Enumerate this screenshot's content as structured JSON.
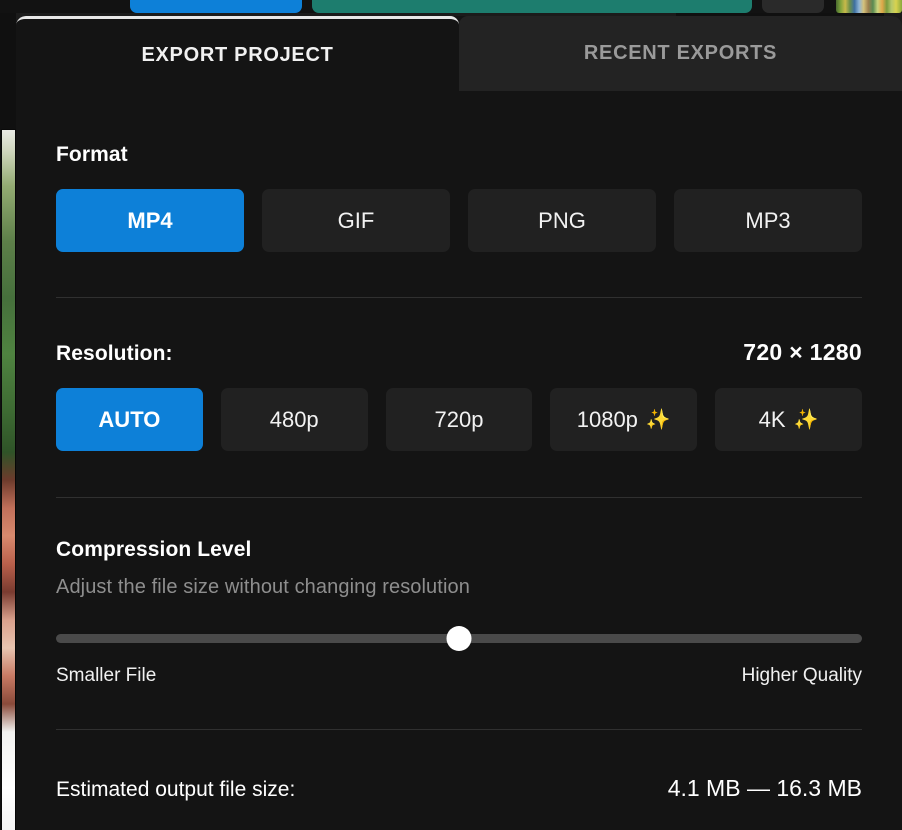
{
  "background": {
    "topbar_pill_blue": "",
    "topbar_pill_teal": "",
    "topbar_pill_dark": "",
    "filmstrip_thumbnail": "",
    "preview_strip": ""
  },
  "modal": {
    "tabs": [
      {
        "label": "EXPORT PROJECT",
        "active": true
      },
      {
        "label": "RECENT EXPORTS",
        "active": false
      }
    ],
    "format": {
      "title": "Format",
      "options": [
        {
          "label": "MP4",
          "selected": true,
          "sparkle": ""
        },
        {
          "label": "GIF",
          "selected": false,
          "sparkle": ""
        },
        {
          "label": "PNG",
          "selected": false,
          "sparkle": ""
        },
        {
          "label": "MP3",
          "selected": false,
          "sparkle": ""
        }
      ]
    },
    "resolution": {
      "title": "Resolution:",
      "value": "720 × 1280",
      "options": [
        {
          "label": "AUTO",
          "selected": true,
          "sparkle": ""
        },
        {
          "label": "480p",
          "selected": false,
          "sparkle": ""
        },
        {
          "label": "720p",
          "selected": false,
          "sparkle": ""
        },
        {
          "label": "1080p",
          "selected": false,
          "sparkle": "✨"
        },
        {
          "label": "4K",
          "selected": false,
          "sparkle": "✨"
        }
      ]
    },
    "compression": {
      "title": "Compression Level",
      "description": "Adjust the file size without changing resolution",
      "slider_percent": 50,
      "label_left": "Smaller File",
      "label_right": "Higher Quality"
    },
    "estimate": {
      "label": "Estimated output file size:",
      "value": "4.1 MB — 16.3 MB"
    }
  },
  "colors": {
    "accent_blue": "#0d80d8",
    "sparkle_gold": "#f5b921",
    "modal_bg": "#141414",
    "button_bg": "#212121",
    "tab_inactive_bg": "#232323"
  }
}
